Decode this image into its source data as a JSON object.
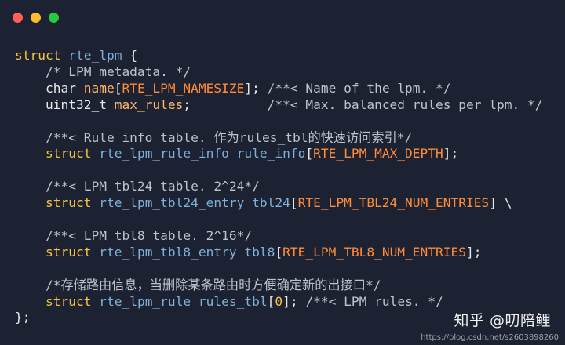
{
  "window": {
    "controls": [
      "close",
      "minimize",
      "maximize"
    ],
    "colors": {
      "close": "#ff5f57",
      "minimize": "#febc2e",
      "maximize": "#28c840",
      "background": "#1c2231"
    }
  },
  "code": {
    "l1": {
      "kw": "struct",
      "type": " rte_lpm",
      "rest": " {"
    },
    "l2": {
      "comment": "    /* LPM metadata. */"
    },
    "l3": {
      "kw": "    char",
      "sp": " ",
      "var": "name",
      "br1": "[",
      "macro": "RTE_LPM_NAMESIZE",
      "br2": "];",
      "comment": " /**< Name of the lpm. */"
    },
    "l4": {
      "kw": "    uint32_t",
      "sp": " ",
      "var": "max_rules",
      "semi": ";",
      "comment": "          /**< Max. balanced rules per lpm. */"
    },
    "l5": "",
    "l6": {
      "comment": "    /**< Rule info table. 作为rules_tbl的快速访问索引*/"
    },
    "l7": {
      "kw": "    struct",
      "type": " rte_lpm_rule_info rule_info",
      "br1": "[",
      "macro": "RTE_LPM_MAX_DEPTH",
      "br2": "];"
    },
    "l8": "",
    "l9": {
      "comment": "    /**< LPM tbl24 table. 2^24*/"
    },
    "l10": {
      "kw": "    struct",
      "type": " rte_lpm_tbl24_entry tbl24",
      "br1": "[",
      "macro": "RTE_LPM_TBL24_NUM_ENTRIES",
      "br2": "] \\"
    },
    "l11": "",
    "l12": {
      "comment": "    /**< LPM tbl8 table. 2^16*/"
    },
    "l13": {
      "kw": "    struct",
      "type": " rte_lpm_tbl8_entry tbl8",
      "br1": "[",
      "macro": "RTE_LPM_TBL8_NUM_ENTRIES",
      "br2": "];"
    },
    "l14": "",
    "l15": {
      "comment": "    /*存储路由信息，当删除某条路由时方便确定新的出接口*/"
    },
    "l16": {
      "kw": "    struct",
      "type": " rte_lpm_rule rules_tbl",
      "br1": "[",
      "num": "0",
      "br2": "];",
      "comment": " /**< LPM rules. */"
    },
    "l17": {
      "rest": "};"
    }
  },
  "watermark": {
    "main": "知乎 @叨陪鲤",
    "url": "https://blog.csdn.net/s2603898260"
  }
}
